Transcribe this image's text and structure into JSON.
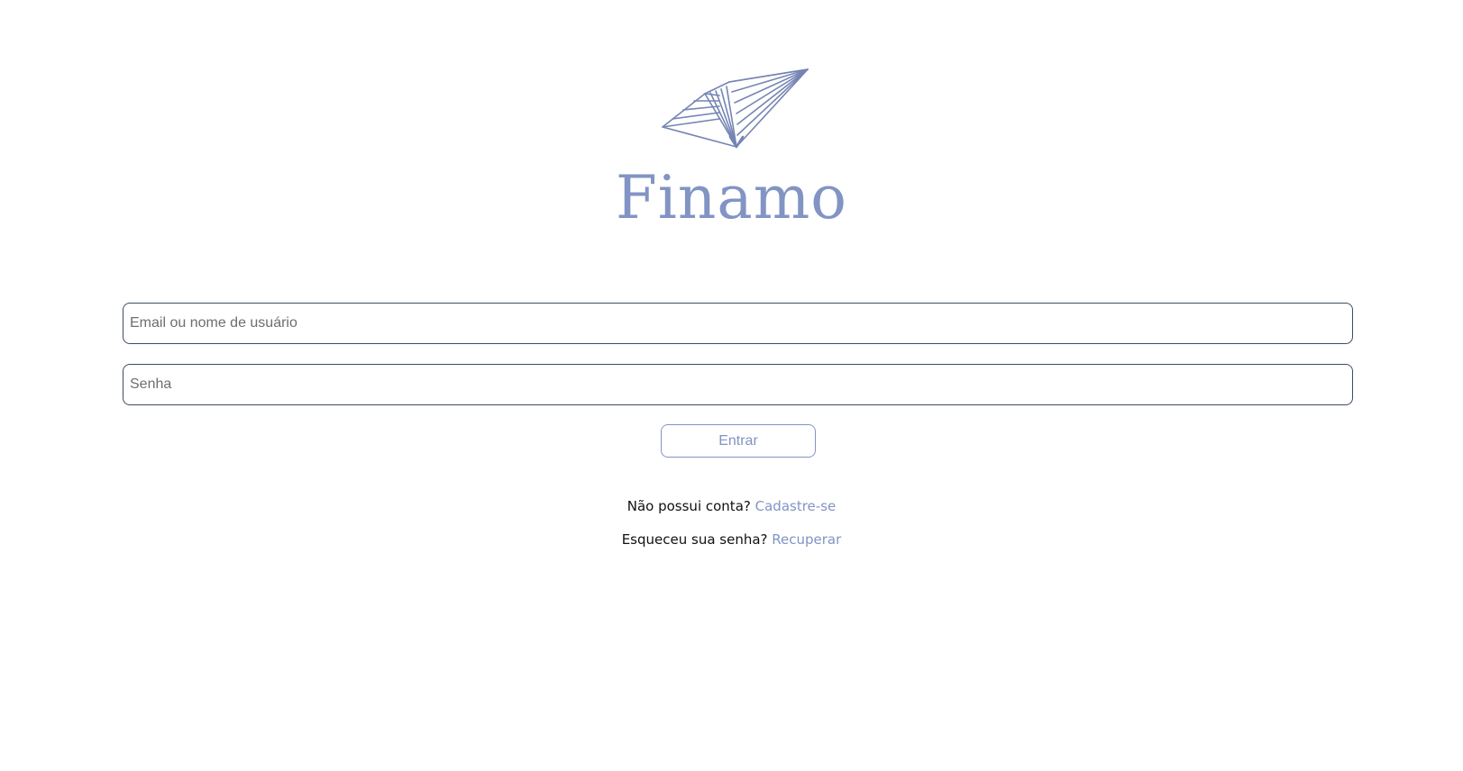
{
  "brand": {
    "name": "Finamo",
    "logo_icon": "paper-plane-icon",
    "color": "#8294c4"
  },
  "login": {
    "username_placeholder": "Email ou nome de usuário",
    "username_value": "",
    "password_placeholder": "Senha",
    "password_value": "",
    "submit_label": "Entrar"
  },
  "signup": {
    "prompt": "Não possui conta?",
    "link_label": "Cadastre-se"
  },
  "recover": {
    "prompt": "Esqueceu sua senha?",
    "link_label": "Recuperar"
  },
  "colors": {
    "accent": "#8294c4",
    "field_border": "#3f4b63",
    "background": "#ffffff"
  }
}
